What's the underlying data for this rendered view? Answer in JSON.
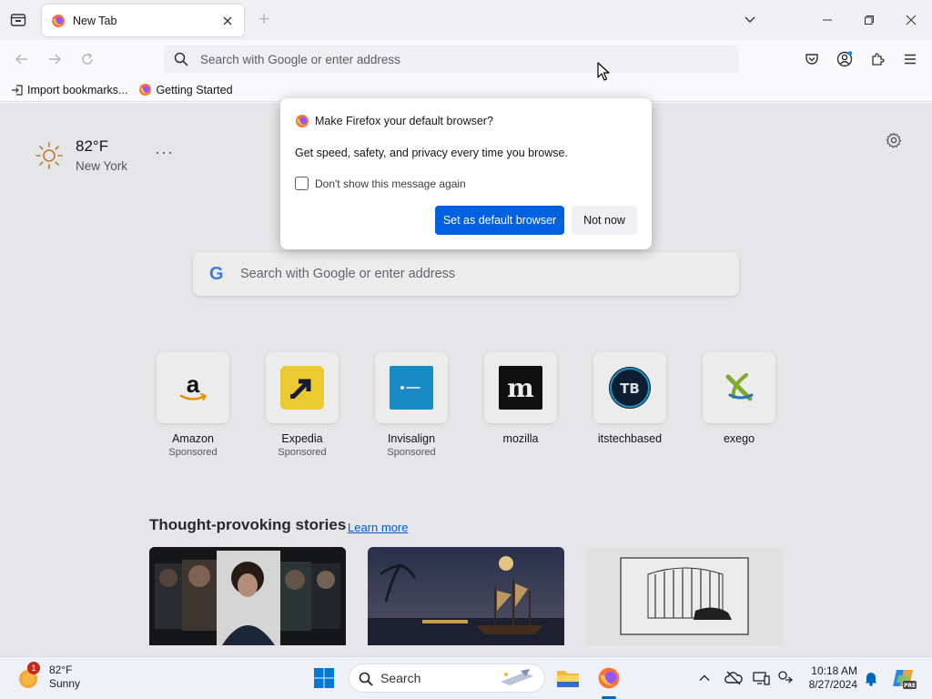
{
  "tabstrip": {
    "tab_title": "New Tab",
    "new_tab_symbol": "+"
  },
  "navbar": {
    "url_placeholder": "Search with Google or enter address"
  },
  "bookmarks": {
    "items": [
      {
        "label": "Import bookmarks...",
        "icon": "import-icon"
      },
      {
        "label": "Getting Started",
        "icon": "firefox-icon"
      }
    ]
  },
  "weather": {
    "temp": "82°F",
    "city": "New York",
    "more": "···"
  },
  "search": {
    "placeholder": "Search with Google or enter address",
    "logo": "G"
  },
  "shortcuts": [
    {
      "name": "Amazon",
      "sponsored": "Sponsored"
    },
    {
      "name": "Expedia",
      "sponsored": "Sponsored"
    },
    {
      "name": "Invisalign",
      "sponsored": "Sponsored"
    },
    {
      "name": "mozilla",
      "sponsored": ""
    },
    {
      "name": "itstechbased",
      "sponsored": ""
    },
    {
      "name": "exego",
      "sponsored": ""
    }
  ],
  "stories": {
    "heading": "Thought-provoking stories",
    "learn_more": "Learn more"
  },
  "dialog": {
    "title": "Make Firefox your default browser?",
    "body": "Get speed, safety, and privacy every time you browse.",
    "checkbox_label": "Don't show this message again",
    "primary_button": "Set as default browser",
    "secondary_button": "Not now"
  },
  "taskbar": {
    "weather_temp": "82°F",
    "weather_desc": "Sunny",
    "weather_badge": "1",
    "search_label": "Search",
    "time": "10:18 AM",
    "date": "8/27/2024",
    "copilot_badge": "PRE"
  },
  "colors": {
    "accent": "#0061e0",
    "tabstrip_bg": "#f0f0f4",
    "page_bg": "#f9f9fb"
  }
}
